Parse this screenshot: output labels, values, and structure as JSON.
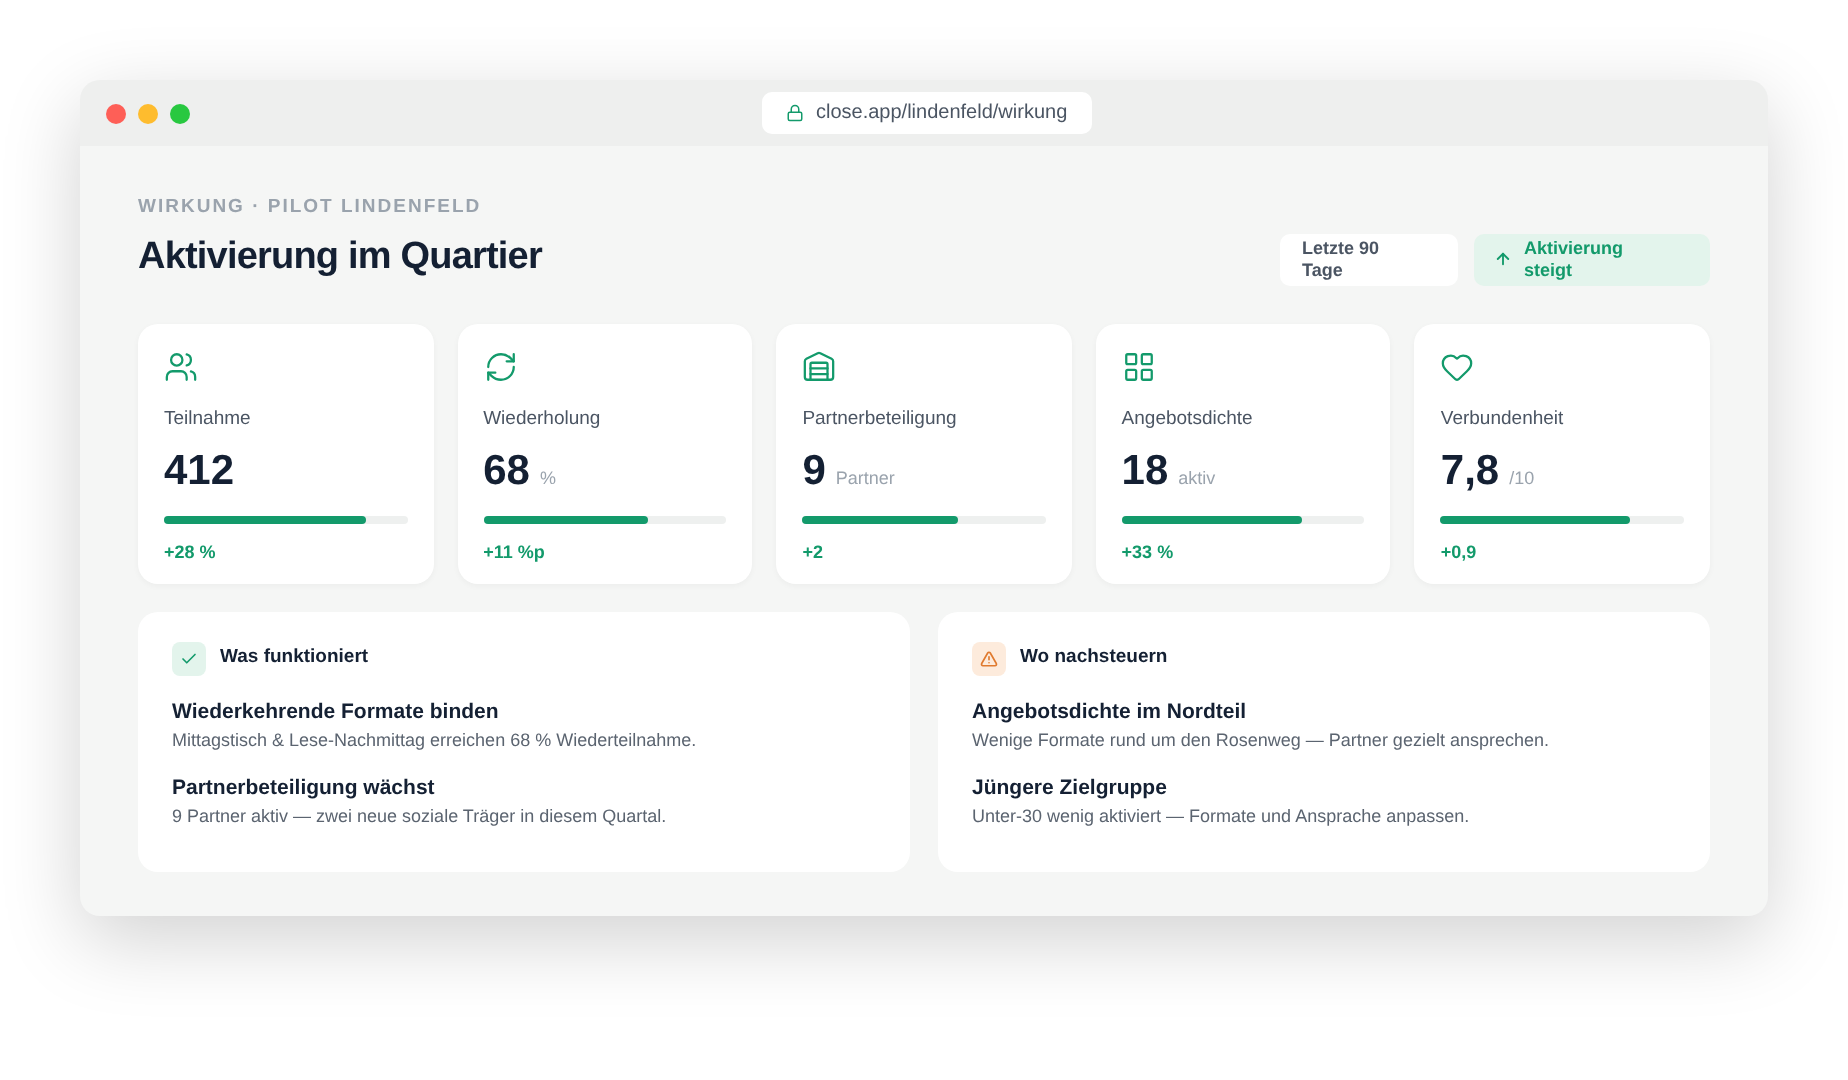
{
  "browser": {
    "url": "close.app/lindenfeld/wirkung"
  },
  "header": {
    "eyebrow": "WIRKUNG · PILOT LINDENFELD",
    "title": "Aktivierung im Quartier",
    "period": "Letzte 90 Tage",
    "trend": "Aktivierung steigt"
  },
  "metrics": [
    {
      "kind": "people",
      "label": "Teilnahme",
      "value": "412",
      "level": 0.83,
      "delta": "+28 %"
    },
    {
      "kind": "refresh",
      "label": "Wiederholung",
      "value": "68",
      "unit": "%",
      "level": 0.68,
      "delta": "+11 %p"
    },
    {
      "kind": "building",
      "label": "Partnerbeteiligung",
      "value": "9",
      "unit": "Partner",
      "level": 0.64,
      "delta": "+2"
    },
    {
      "kind": "grid",
      "label": "Angebotsdichte",
      "value": "18",
      "unit": "aktiv",
      "level": 0.74,
      "delta": "+33 %"
    },
    {
      "kind": "heart",
      "label": "Verbundenheit",
      "value": "7,8",
      "unit": "/10",
      "level": 0.78,
      "delta": "+0,9"
    }
  ],
  "panels": [
    {
      "kind": "good",
      "title": "Was funktioniert",
      "items": [
        {
          "title": "Wiederkehrende Formate binden",
          "text": "Mittagstisch & Lese-Nachmittag erreichen 68 % Wiederteilnahme."
        },
        {
          "title": "Partnerbeteiligung wächst",
          "text": "9 Partner aktiv — zwei neue soziale Träger in diesem Quartal."
        }
      ]
    },
    {
      "kind": "warn",
      "title": "Wo nachsteuern",
      "items": [
        {
          "title": "Angebotsdichte im Nordteil",
          "text": "Wenige Formate rund um den Rosenweg — Partner gezielt ansprechen."
        },
        {
          "title": "Jüngere Zielgruppe",
          "text": "Unter-30 wenig aktiviert — Formate und Ansprache anpassen."
        }
      ]
    }
  ]
}
